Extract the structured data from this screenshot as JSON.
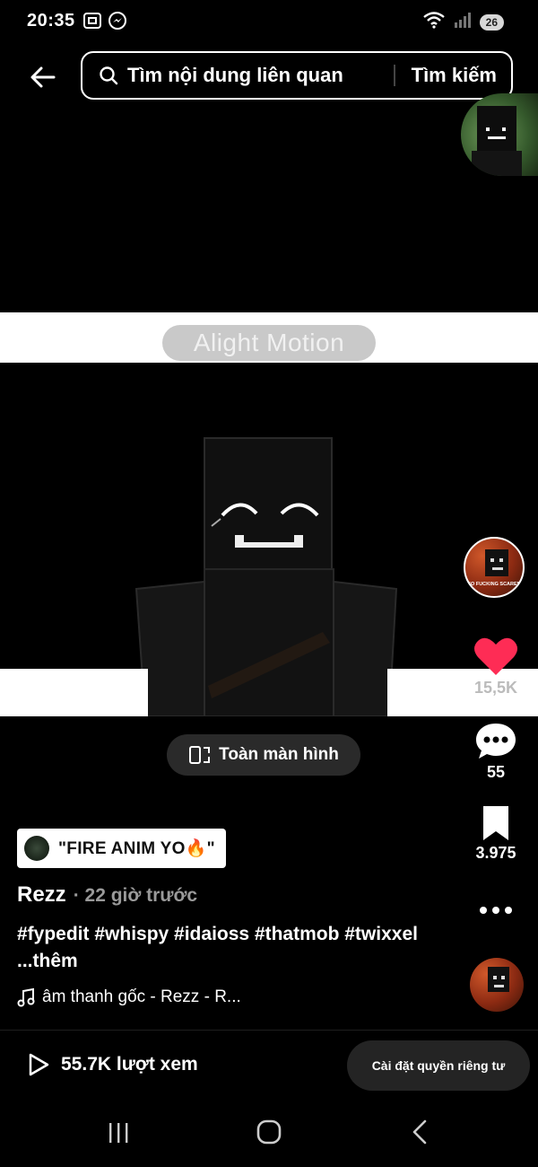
{
  "status_bar": {
    "time": "20:35",
    "battery": "26",
    "left_icons": [
      "screenshot-icon",
      "messenger-icon"
    ],
    "right_icons": [
      "wifi-icon",
      "signal-icon",
      "battery-icon"
    ]
  },
  "search": {
    "query": "Tìm nội dung liên quan",
    "button_label": "Tìm kiếm"
  },
  "video": {
    "watermark": "Alight Motion",
    "fullscreen_label": "Toàn màn hình"
  },
  "rail": {
    "likes": "15,5K",
    "comments": "55",
    "saves": "3.975",
    "avatar_badge": "SO FUCKING SCARED"
  },
  "caption": {
    "sticker_text": "\"FIRE ANIM YO🔥\"",
    "author": "Rezz",
    "posted_time": "· 22 giờ trước",
    "hashtags": "#fypedit #whispy #idaioss #thatmob #twixxel",
    "more": "...thêm",
    "sound": "âm thanh gốc - Rezz - R..."
  },
  "footer": {
    "views": "55.7K lượt xem",
    "privacy_button": "Cài đặt quyền riêng tư"
  },
  "colors": {
    "like": "#fe2c55",
    "background": "#000000",
    "pill": "#2a2a2a"
  }
}
